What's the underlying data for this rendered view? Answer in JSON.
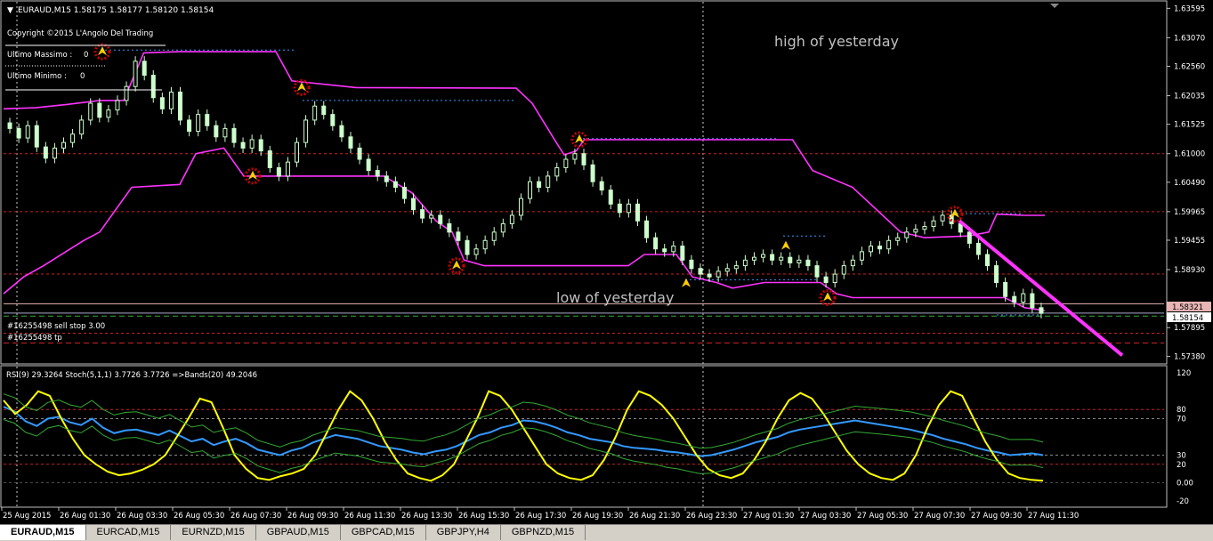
{
  "header": {
    "symbol_line": "EURAUD,M15  1.58175 1.58177 1.58120 1.58154",
    "copyright": "Copyright ©2015 L'Angolo Del Trading",
    "ultimo_massimo_label": "Ultimo Massimo :",
    "ultimo_massimo_value": "0",
    "ultimo_minimo_label": "Ultimo Minimo  :",
    "ultimo_minimo_value": "0"
  },
  "annotations": {
    "high_of_yesterday": "high of yesterday",
    "low_of_yesterday": "low of yesterday",
    "order_sell_stop": "#16255498 sell stop 3.00",
    "order_tp": "#16255498 tp",
    "bid_tag": "1.58154",
    "ask_tag": "1.58321"
  },
  "indicator_header": "RSI(9) 29.3264 Stoch(5,1,1) 3.7726 3.7726 =>Bands(20) 49.2046",
  "tabs": [
    "EURAUD,M15",
    "EURCAD,M15",
    "EURNZD,M15",
    "GBPAUD,M15",
    "GBPCAD,M15",
    "GBPJPY,H4",
    "GBPNZD,M15"
  ],
  "active_tab": "EURAUD,M15",
  "colors": {
    "background": "#000000",
    "bull_candle": "#ccffcc",
    "bear_candle": "#ccffcc",
    "envelope": "#ff33ff",
    "trend_line": "#ff33ff",
    "rsi": "#3399ff",
    "stoch": "#ffff00",
    "bands": "#33aa33",
    "level_red": "#cc2222",
    "level_green": "#33aa33",
    "bid_line": "#aaaacc",
    "marker_star": "#cc0000",
    "marker_arrow": "#ffcc00"
  },
  "chart_data": [
    {
      "type": "candlestick",
      "symbol": "EURAUD",
      "timeframe": "M15",
      "y_ticks": [
        1.63595,
        1.6307,
        1.6256,
        1.62035,
        1.61525,
        1.61,
        1.6049,
        1.59965,
        1.59455,
        1.5893,
        1.58154,
        1.57895,
        1.5738
      ],
      "ylim": [
        1.5731,
        1.6368
      ],
      "x_tick_labels": [
        "25 Aug 2015",
        "26 Aug 01:30",
        "26 Aug 03:30",
        "26 Aug 05:30",
        "26 Aug 07:30",
        "26 Aug 09:30",
        "26 Aug 11:30",
        "26 Aug 13:30",
        "26 Aug 15:30",
        "26 Aug 17:30",
        "26 Aug 19:30",
        "26 Aug 21:30",
        "26 Aug 23:30",
        "27 Aug 01:30",
        "27 Aug 03:30",
        "27 Aug 05:30",
        "27 Aug 07:30",
        "27 Aug 09:30",
        "27 Aug 11:30"
      ],
      "close_series": [
        1.6145,
        1.6128,
        1.615,
        1.6112,
        1.6092,
        1.611,
        1.612,
        1.6135,
        1.616,
        1.619,
        1.6165,
        1.6178,
        1.6195,
        1.622,
        1.6265,
        1.624,
        1.62,
        1.618,
        1.621,
        1.616,
        1.614,
        1.617,
        1.615,
        1.613,
        1.6145,
        1.612,
        1.611,
        1.6125,
        1.6105,
        1.6075,
        1.606,
        1.6085,
        1.612,
        1.616,
        1.6185,
        1.617,
        1.615,
        1.613,
        1.611,
        1.609,
        1.607,
        1.606,
        1.605,
        1.604,
        1.602,
        1.6,
        1.5985,
        1.599,
        1.5975,
        1.596,
        1.5945,
        1.592,
        1.593,
        1.5945,
        1.596,
        1.5975,
        1.599,
        1.602,
        1.605,
        1.604,
        1.606,
        1.6075,
        1.609,
        1.61,
        1.608,
        1.605,
        1.6035,
        1.601,
        1.5995,
        1.601,
        1.598,
        1.595,
        1.593,
        1.5925,
        1.5935,
        1.591,
        1.5895,
        1.5885,
        1.588,
        1.589,
        1.5895,
        1.59,
        1.591,
        1.5915,
        1.592,
        1.591,
        1.5915,
        1.5905,
        1.591,
        1.59,
        1.588,
        1.587,
        1.5885,
        1.59,
        1.591,
        1.5925,
        1.5935,
        1.593,
        1.5945,
        1.595,
        1.596,
        1.5965,
        1.597,
        1.598,
        1.599,
        1.5975,
        1.596,
        1.594,
        1.592,
        1.59,
        1.587,
        1.5845,
        1.5835,
        1.585,
        1.5825,
        1.5815
      ],
      "envelope_high": [
        [
          1.618,
          0
        ],
        [
          1.6182,
          8
        ],
        [
          1.6188,
          16
        ],
        [
          1.6195,
          24
        ],
        [
          1.6195,
          30
        ],
        [
          1.628,
          35
        ],
        [
          1.6282,
          44
        ],
        [
          1.6282,
          64
        ],
        [
          1.6282,
          68
        ],
        [
          1.623,
          72
        ],
        [
          1.6218,
          88
        ],
        [
          1.6217,
          128
        ],
        [
          1.619,
          132
        ],
        [
          1.612,
          138
        ],
        [
          1.6098,
          140
        ],
        [
          1.6105,
          143
        ],
        [
          1.6125,
          145
        ],
        [
          1.6125,
          197
        ],
        [
          1.607,
          202
        ],
        [
          1.604,
          212
        ],
        [
          1.596,
          224
        ],
        [
          1.595,
          230
        ],
        [
          1.5953,
          241
        ],
        [
          1.596,
          246
        ],
        [
          1.5992,
          248
        ],
        [
          1.599,
          255
        ],
        [
          1.599,
          260
        ]
      ],
      "envelope_low": [
        [
          1.585,
          0
        ],
        [
          1.588,
          5
        ],
        [
          1.59,
          10
        ],
        [
          1.5945,
          20
        ],
        [
          1.596,
          24
        ],
        [
          1.604,
          32
        ],
        [
          1.6045,
          44
        ],
        [
          1.61,
          48
        ],
        [
          1.611,
          55
        ],
        [
          1.606,
          60
        ],
        [
          1.606,
          95
        ],
        [
          1.603,
          102
        ],
        [
          1.598,
          108
        ],
        [
          1.596,
          112
        ],
        [
          1.591,
          115
        ],
        [
          1.59,
          120
        ],
        [
          1.59,
          156
        ],
        [
          1.592,
          160
        ],
        [
          1.592,
          168
        ],
        [
          1.588,
          172
        ],
        [
          1.587,
          178
        ],
        [
          1.586,
          182
        ],
        [
          1.587,
          190
        ],
        [
          1.587,
          204
        ],
        [
          1.585,
          208
        ],
        [
          1.5843,
          212
        ],
        [
          1.5843,
          250
        ],
        [
          1.5825,
          255
        ],
        [
          1.582,
          260
        ]
      ],
      "reference_levels": [
        1.61,
        1.59965,
        1.5885,
        1.57795
      ],
      "order_levels": {
        "sell_stop": 1.581,
        "tp": 1.5762,
        "bid": 1.58154,
        "ask": 1.58321
      }
    },
    {
      "type": "line",
      "name": "indicator_window",
      "y_ticks": [
        "120",
        "80",
        "70",
        "30",
        "20",
        "0.00",
        "-20"
      ],
      "ylim": [
        -25,
        125
      ],
      "levels": [
        80,
        70,
        30,
        20,
        0
      ],
      "series": [
        {
          "key": "rsi",
          "values": [
            83,
            78,
            67,
            62,
            70,
            72,
            66,
            63,
            70,
            60,
            54,
            57,
            58,
            55,
            52,
            57,
            51,
            45,
            48,
            41,
            45,
            48,
            43,
            36,
            33,
            30,
            35,
            38,
            44,
            48,
            52,
            50,
            48,
            44,
            40,
            38,
            36,
            33,
            31,
            34,
            36,
            40,
            46,
            52,
            55,
            60,
            63,
            68,
            67,
            64,
            60,
            55,
            52,
            48,
            46,
            44,
            40,
            38,
            37,
            36,
            34,
            33,
            31,
            29,
            30,
            33,
            36,
            40,
            44,
            47,
            50,
            55,
            58,
            60,
            62,
            64,
            66,
            68,
            66,
            64,
            62,
            60,
            58,
            55,
            52,
            48,
            45,
            42,
            38,
            35,
            33,
            30,
            31,
            32,
            30
          ]
        },
        {
          "key": "stoch",
          "values": [
            90,
            75,
            85,
            100,
            95,
            70,
            48,
            30,
            20,
            12,
            8,
            10,
            14,
            20,
            30,
            50,
            70,
            92,
            88,
            60,
            30,
            15,
            5,
            3,
            7,
            10,
            15,
            30,
            55,
            80,
            100,
            90,
            70,
            45,
            25,
            10,
            5,
            2,
            8,
            20,
            45,
            70,
            100,
            95,
            80,
            60,
            40,
            20,
            10,
            5,
            3,
            8,
            25,
            50,
            80,
            100,
            95,
            85,
            70,
            50,
            30,
            15,
            8,
            5,
            10,
            25,
            45,
            70,
            90,
            98,
            92,
            75,
            55,
            35,
            20,
            10,
            5,
            3,
            10,
            30,
            60,
            85,
            100,
            95,
            70,
            45,
            25,
            10,
            5,
            3,
            2
          ]
        }
      ]
    }
  ]
}
